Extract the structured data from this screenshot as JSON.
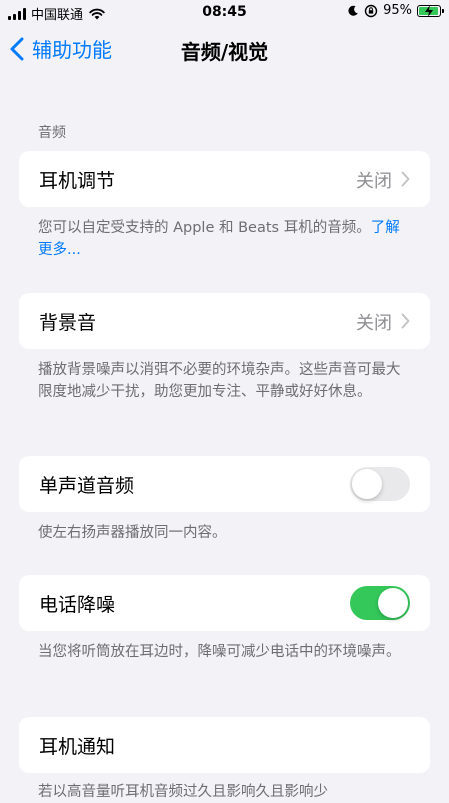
{
  "status_bar": {
    "carrier": "中国联通",
    "time": "08:45",
    "battery_pct": "95%",
    "battery_level": 0.95
  },
  "nav": {
    "back_label": "辅助功能",
    "title": "音频/视觉"
  },
  "sections": {
    "audio_header": "音频",
    "headphone": {
      "label": "耳机调节",
      "value": "关闭",
      "footer": "您可以自定受支持的 Apple 和 Beats 耳机的音频。",
      "footer_link": "了解更多..."
    },
    "bg_sound": {
      "label": "背景音",
      "value": "关闭",
      "footer": "播放背景噪声以消弭不必要的环境杂声。这些声音可最大限度地减少干扰，助您更加专注、平静或好好休息。"
    },
    "mono": {
      "label": "单声道音频",
      "state": "off",
      "footer": "使左右扬声器播放同一内容。"
    },
    "noise_cancel": {
      "label": "电话降噪",
      "state": "on",
      "footer": "当您将听筒放在耳边时，降噪可减少电话中的环境噪声。"
    },
    "headphone_notify": {
      "label": "耳机通知",
      "footer": "若以高音量听耳机音频过久且影响久且影响少"
    }
  },
  "colors": {
    "accent": "#007aff",
    "toggle_on": "#34c759",
    "background": "#f2f2f7"
  }
}
